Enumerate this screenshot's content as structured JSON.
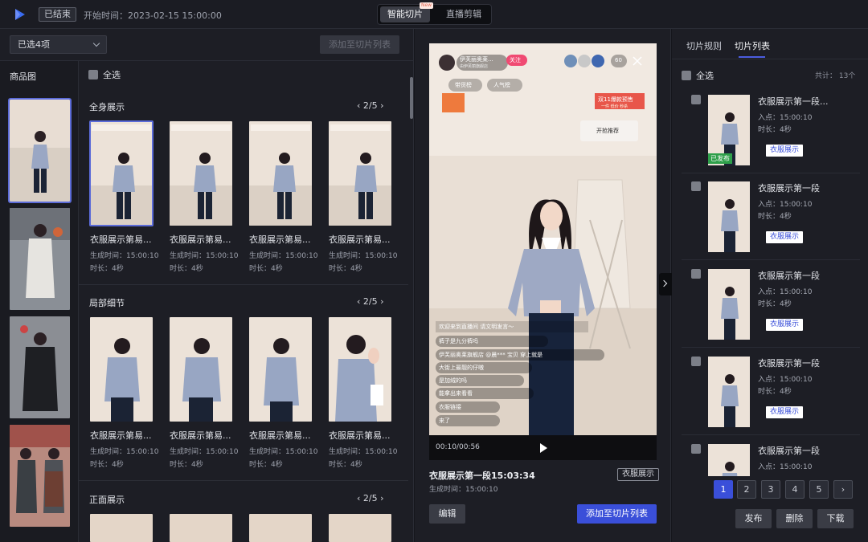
{
  "header": {
    "status_badge": "已结束",
    "start_time": "开始时间：2023-02-15 15:00:00",
    "modes": [
      "智能切片",
      "直播剪辑"
    ],
    "new_tag": "New"
  },
  "left": {
    "selected_dropdown": "已选4项",
    "add_list_button": "添加至切片列表",
    "product_header": "商品图",
    "select_all": "全选",
    "sections": [
      {
        "title": "全身展示",
        "pager": "2/5",
        "clips": [
          {
            "title": "衣服展示第易...",
            "time": "生成时间：15:00:10",
            "duration": "时长：4秒"
          },
          {
            "title": "衣服展示第易...",
            "time": "生成时间：15:00:10",
            "duration": "时长：4秒"
          },
          {
            "title": "衣服展示第易...",
            "time": "生成时间：15:00:10",
            "duration": "时长：4秒"
          },
          {
            "title": "衣服展示第易...",
            "time": "生成时间：15:00:10",
            "duration": "时长：4秒"
          }
        ]
      },
      {
        "title": "局部细节",
        "pager": "2/5",
        "clips": [
          {
            "title": "衣服展示第易...",
            "time": "生成时间：15:00:10",
            "duration": "时长：4秒"
          },
          {
            "title": "衣服展示第易...",
            "time": "生成时间：15:00:10",
            "duration": "时长：4秒"
          },
          {
            "title": "衣服展示第易...",
            "time": "生成时间：15:00:10",
            "duration": "时长：4秒"
          },
          {
            "title": "衣服展示第易...",
            "time": "生成时间：15:00:10",
            "duration": "时长：4秒"
          }
        ]
      },
      {
        "title": "正面展示",
        "pager": "2/5"
      }
    ]
  },
  "player": {
    "streamer_name": "伊芙丽奥莱...",
    "streamer_sub": "由伊芙丽旗舰店",
    "follow": "关注",
    "viewers": "60",
    "tag1": "带货榜",
    "tag2": "人气榜",
    "promo": "双11爆款预售",
    "promo_sub": "一件 低价 秒杀",
    "product_card": "开抢推荐",
    "comments": [
      "欢迎来到直播间 请文明发言～",
      "裤子是九分裤吗",
      "伊芙丽奥莱旗舰店 @晨*** 宝贝 穿上就是",
      "大街上最靓的仔嗷",
      "是加绒的吗",
      "能拿出来看看",
      "衣服链接",
      "来了"
    ],
    "time": "00:10/00:56",
    "clip_name": "衣服展示第一段15:03:34",
    "gen_time": "生成时间：15:00:10",
    "tag": "衣服展示",
    "edit": "编辑",
    "add_to_list": "添加至切片列表"
  },
  "right": {
    "tabs": [
      "切片规则",
      "切片列表"
    ],
    "select_all": "全选",
    "total": "共计：    13个",
    "items": [
      {
        "title": "衣服展示第一段...",
        "in": "入点：15:00:10",
        "duration": "时长：4秒",
        "tag": "衣服展示",
        "published": "已发布"
      },
      {
        "title": "衣服展示第一段",
        "in": "入点：15:00:10",
        "duration": "时长：4秒",
        "tag": "衣服展示"
      },
      {
        "title": "衣服展示第一段",
        "in": "入点：15:00:10",
        "duration": "时长：4秒",
        "tag": "衣服展示"
      },
      {
        "title": "衣服展示第一段",
        "in": "入点：15:00:10",
        "duration": "时长：4秒",
        "tag": "衣服展示"
      },
      {
        "title": "衣服展示第一段",
        "in": "入点：15:00:10"
      }
    ],
    "pages": [
      "1",
      "2",
      "3",
      "4",
      "5"
    ],
    "actions": [
      "发布",
      "删除",
      "下载"
    ]
  },
  "colors": {
    "accent": "#3a4fd9",
    "background": "#1d1e25"
  }
}
